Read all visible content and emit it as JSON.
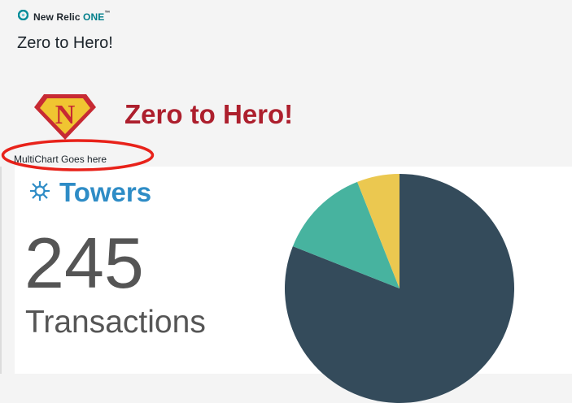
{
  "app": {
    "brand_main": "New Relic ",
    "brand_accent": "ONE",
    "brand_tm": "™"
  },
  "page": {
    "title": "Zero to Hero!"
  },
  "hero": {
    "title": "Zero to Hero!",
    "logo_letter": "N"
  },
  "annotation": {
    "label": "MultiChart Goes here",
    "ellipse_color": "#e8221a"
  },
  "widget": {
    "title": "Towers",
    "value": "245",
    "label": "Transactions"
  },
  "chart_data": {
    "type": "pie",
    "values": [
      81,
      13,
      6
    ],
    "colors": [
      "#344b5b",
      "#47b39f",
      "#ebc850"
    ]
  },
  "colors": {
    "hero_title": "#ad1f2d",
    "towers_title": "#2e8cc6",
    "brand_accent": "#007e8a"
  }
}
